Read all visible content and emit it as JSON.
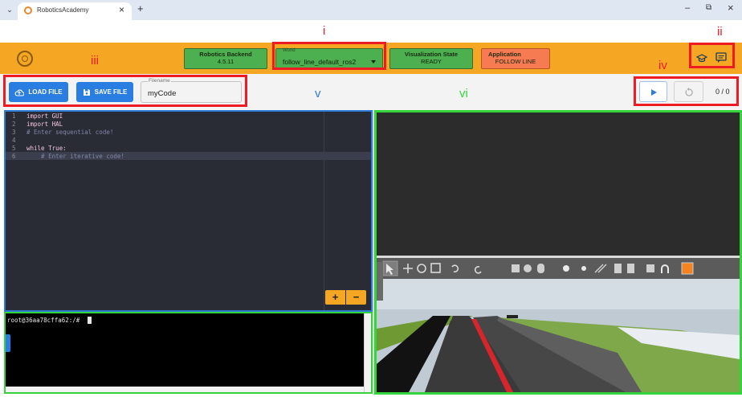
{
  "browser": {
    "tab_title": "RoboticsAcademy",
    "new_tab_label": "+",
    "tab_close_label": "×",
    "window_controls": {
      "minimize": "–",
      "maximize": "⧉",
      "close": "×"
    }
  },
  "header": {
    "robotics_backend": {
      "title": "Robotics Backend",
      "value": "4.5.11"
    },
    "world": {
      "title": "World",
      "value": "follow_line_default_ros2"
    },
    "visualization_state": {
      "title": "Visualization State",
      "value": "READY"
    },
    "application": {
      "title": "Application",
      "value": "FOLLOW LINE"
    },
    "colors": {
      "bar": "#f5a623",
      "green_box": "#4caf50",
      "orange_box": "#f77b52"
    }
  },
  "toolbar": {
    "load_file_label": "LOAD FILE",
    "save_file_label": "SAVE FILE",
    "filename_label": "Filename",
    "filename_value": "myCode",
    "counter": "0 / 0"
  },
  "annotations": {
    "i": "i",
    "ii": "ii",
    "iii": "iii",
    "iv": "iv",
    "v": "v",
    "vi": "vi"
  },
  "editor": {
    "lines": [
      {
        "n": "1",
        "text": "import GUI"
      },
      {
        "n": "2",
        "text": "import HAL"
      },
      {
        "n": "3",
        "text": "# Enter sequential code!"
      },
      {
        "n": "4",
        "text": ""
      },
      {
        "n": "5",
        "text": "while True:"
      },
      {
        "n": "6",
        "text": "    # Enter iterative code!"
      }
    ],
    "zoom_in_label": "+",
    "zoom_out_label": "−"
  },
  "terminal": {
    "prompt": "root@36aa78cffa62:/#"
  }
}
